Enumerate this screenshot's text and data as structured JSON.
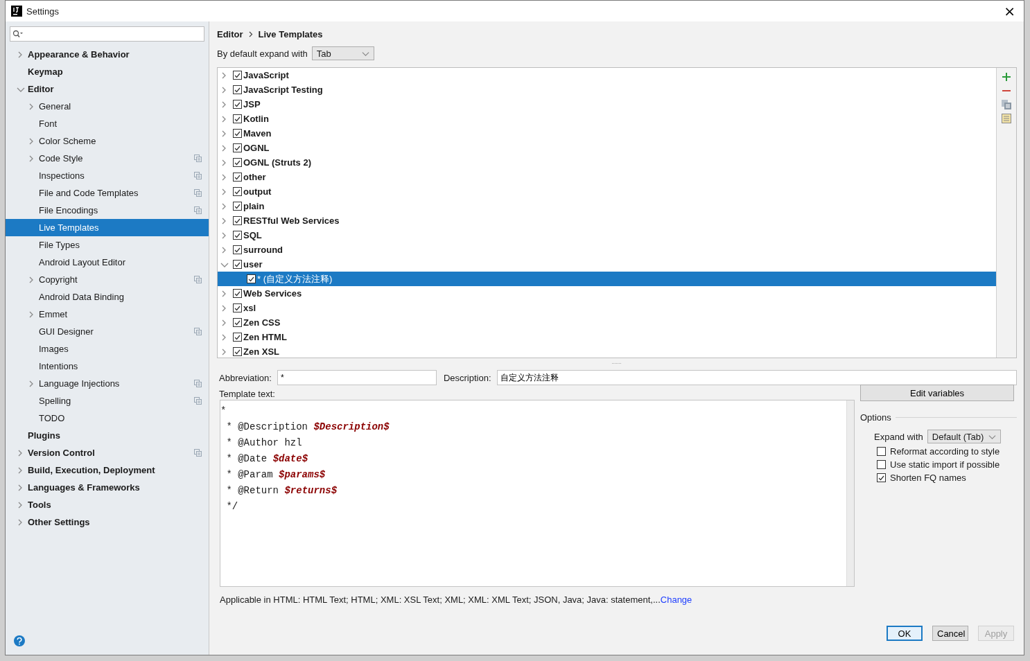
{
  "window": {
    "title": "Settings",
    "close": "×"
  },
  "sidebar": {
    "items": [
      {
        "label": "Appearance & Behavior",
        "expanded": false,
        "selected": false,
        "scheme_icon": false
      },
      {
        "label": "Keymap",
        "selected": false,
        "scheme_icon": false
      },
      {
        "label": "Editor",
        "expanded": true,
        "selected": false,
        "scheme_icon": false,
        "children": [
          {
            "label": "General",
            "expanded": false,
            "selected": false,
            "scheme_icon": false
          },
          {
            "label": "Font",
            "selected": false,
            "scheme_icon": false
          },
          {
            "label": "Color Scheme",
            "expanded": false,
            "selected": false,
            "scheme_icon": false
          },
          {
            "label": "Code Style",
            "expanded": false,
            "selected": false,
            "scheme_icon": true
          },
          {
            "label": "Inspections",
            "selected": false,
            "scheme_icon": true
          },
          {
            "label": "File and Code Templates",
            "selected": false,
            "scheme_icon": true
          },
          {
            "label": "File Encodings",
            "selected": false,
            "scheme_icon": true
          },
          {
            "label": "Live Templates",
            "selected": true,
            "scheme_icon": false
          },
          {
            "label": "File Types",
            "selected": false,
            "scheme_icon": false
          },
          {
            "label": "Android Layout Editor",
            "selected": false,
            "scheme_icon": false
          },
          {
            "label": "Copyright",
            "expanded": false,
            "selected": false,
            "scheme_icon": true
          },
          {
            "label": "Android Data Binding",
            "selected": false,
            "scheme_icon": false
          },
          {
            "label": "Emmet",
            "expanded": false,
            "selected": false,
            "scheme_icon": false
          },
          {
            "label": "GUI Designer",
            "selected": false,
            "scheme_icon": true
          },
          {
            "label": "Images",
            "selected": false,
            "scheme_icon": false
          },
          {
            "label": "Intentions",
            "selected": false,
            "scheme_icon": false
          },
          {
            "label": "Language Injections",
            "expanded": false,
            "selected": false,
            "scheme_icon": true
          },
          {
            "label": "Spelling",
            "selected": false,
            "scheme_icon": true
          },
          {
            "label": "TODO",
            "selected": false,
            "scheme_icon": false
          }
        ]
      },
      {
        "label": "Plugins",
        "selected": false,
        "scheme_icon": false
      },
      {
        "label": "Version Control",
        "expanded": false,
        "selected": false,
        "scheme_icon": true
      },
      {
        "label": "Build, Execution, Deployment",
        "expanded": false,
        "selected": false,
        "scheme_icon": false
      },
      {
        "label": "Languages & Frameworks",
        "expanded": false,
        "selected": false,
        "scheme_icon": false
      },
      {
        "label": "Tools",
        "expanded": false,
        "selected": false,
        "scheme_icon": false
      },
      {
        "label": "Other Settings",
        "expanded": false,
        "selected": false,
        "scheme_icon": false
      }
    ]
  },
  "breadcrumb": [
    "Editor",
    "Live Templates"
  ],
  "default_expand": {
    "label": "By default expand with",
    "value": "Tab"
  },
  "templates": [
    {
      "label": "JavaScript",
      "checked": true,
      "expanded": false,
      "selected": false
    },
    {
      "label": "JavaScript Testing",
      "checked": true,
      "expanded": false,
      "selected": false
    },
    {
      "label": "JSP",
      "checked": true,
      "expanded": false,
      "selected": false
    },
    {
      "label": "Kotlin",
      "checked": true,
      "expanded": false,
      "selected": false
    },
    {
      "label": "Maven",
      "checked": true,
      "expanded": false,
      "selected": false
    },
    {
      "label": "OGNL",
      "checked": true,
      "expanded": false,
      "selected": false
    },
    {
      "label": "OGNL (Struts 2)",
      "checked": true,
      "expanded": false,
      "selected": false
    },
    {
      "label": "other",
      "checked": true,
      "expanded": false,
      "selected": false
    },
    {
      "label": "output",
      "checked": true,
      "expanded": false,
      "selected": false
    },
    {
      "label": "plain",
      "checked": true,
      "expanded": false,
      "selected": false
    },
    {
      "label": "RESTful Web Services",
      "checked": true,
      "expanded": false,
      "selected": false
    },
    {
      "label": "SQL",
      "checked": true,
      "expanded": false,
      "selected": false
    },
    {
      "label": "surround",
      "checked": true,
      "expanded": false,
      "selected": false
    },
    {
      "label": "user",
      "checked": true,
      "expanded": true,
      "selected": false,
      "children": [
        {
          "label": "* (自定义方法注释)",
          "checked": true,
          "selected": true
        }
      ]
    },
    {
      "label": "Web Services",
      "checked": true,
      "expanded": false,
      "selected": false
    },
    {
      "label": "xsl",
      "checked": true,
      "expanded": false,
      "selected": false
    },
    {
      "label": "Zen CSS",
      "checked": true,
      "expanded": false,
      "selected": false
    },
    {
      "label": "Zen HTML",
      "checked": true,
      "expanded": false,
      "selected": false
    },
    {
      "label": "Zen XSL",
      "checked": true,
      "expanded": false,
      "selected": false
    }
  ],
  "abbreviation": {
    "label": "Abbreviation:",
    "value": "*"
  },
  "description": {
    "label": "Description:",
    "value": "自定义方法注释"
  },
  "template_text": {
    "label": "Template text:",
    "lines": [
      "*",
      " * @Description **$Description$**",
      " * @Author hzl",
      " * @Date **$date$**",
      " * @Param **$params$**",
      " * @Return **$returns$**",
      " */"
    ]
  },
  "edit_variables": "Edit variables",
  "options": {
    "title": "Options",
    "expand_label": "Expand with",
    "expand_value": "Default (Tab)",
    "checkboxes": [
      {
        "label": "Reformat according to style",
        "checked": false
      },
      {
        "label": "Use static import if possible",
        "checked": false
      },
      {
        "label": "Shorten FQ names",
        "checked": true
      }
    ]
  },
  "applicable": {
    "text": "Applicable in HTML: HTML Text; HTML; XML: XSL Text; XML; XML: XML Text; JSON, Java; Java: statement,...",
    "link": "Change"
  },
  "buttons": [
    {
      "label": "OK",
      "default": true,
      "disabled": false
    },
    {
      "label": "Cancel",
      "default": false,
      "disabled": false
    },
    {
      "label": "Apply",
      "default": false,
      "disabled": true
    }
  ]
}
